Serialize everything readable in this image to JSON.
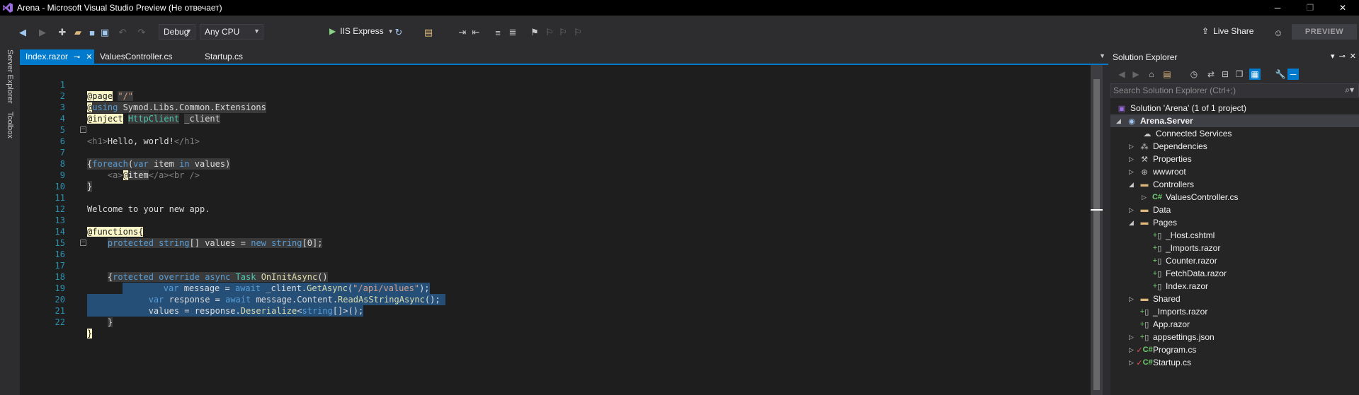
{
  "window": {
    "title": "Arena - Microsoft Visual Studio Preview (Не отвечает)",
    "controls": [
      "─",
      "❐",
      "✕"
    ]
  },
  "toolbar": {
    "config": "Debug",
    "platform": "Any CPU",
    "run_target": "IIS Express",
    "live_share": "Live Share",
    "preview": "PREVIEW"
  },
  "side_tools": [
    "Server Explorer",
    "Toolbox"
  ],
  "tabs": [
    {
      "label": "Index.razor",
      "active": true
    },
    {
      "label": "ValuesController.cs",
      "active": false
    },
    {
      "label": "Startup.cs",
      "active": false
    }
  ],
  "code_lines": [
    {
      "n": "1",
      "text": "@page \"/\""
    },
    {
      "n": "2",
      "text": "@using Symod.Libs.Common.Extensions"
    },
    {
      "n": "3",
      "text": "@inject HttpClient _client"
    },
    {
      "n": "4",
      "text": ""
    },
    {
      "n": "5",
      "text": "<h1>Hello, world!</h1>"
    },
    {
      "n": "6",
      "text": "@foreach(var item in values)"
    },
    {
      "n": "7",
      "text": "{"
    },
    {
      "n": "8",
      "text": "    <a>@item</a><br />"
    },
    {
      "n": "9",
      "text": "}"
    },
    {
      "n": "10",
      "text": ""
    },
    {
      "n": "11",
      "text": "Welcome to your new app."
    },
    {
      "n": "12",
      "text": ""
    },
    {
      "n": "13",
      "text": "@functions{"
    },
    {
      "n": "14",
      "text": "    protected string[] values = new string[0];"
    },
    {
      "n": "15",
      "text": ""
    },
    {
      "n": "16",
      "text": "    protected override async Task OnInitAsync()"
    },
    {
      "n": "17",
      "text": "    {"
    },
    {
      "n": "18",
      "text": "        var message = await _client.GetAsync(\"/api/values\");"
    },
    {
      "n": "19",
      "text": "        var response = await message.Content.ReadAsStringAsync();"
    },
    {
      "n": "20",
      "text": "        values = response.Deserialize<string[]>();"
    },
    {
      "n": "21",
      "text": "    }"
    },
    {
      "n": "22",
      "text": "}"
    }
  ],
  "solution_explorer": {
    "title": "Solution Explorer",
    "search_placeholder": "Search Solution Explorer (Ctrl+;)",
    "nodes": [
      {
        "label": "Solution 'Arena' (1 of 1 project)",
        "icon": "solution-icon"
      },
      {
        "label": "Arena.Server",
        "icon": "web-project-icon"
      },
      {
        "label": "Connected Services",
        "icon": "connected-services-icon"
      },
      {
        "label": "Dependencies",
        "icon": "dependencies-icon"
      },
      {
        "label": "Properties",
        "icon": "wrench-icon"
      },
      {
        "label": "wwwroot",
        "icon": "globe-icon"
      },
      {
        "label": "Controllers",
        "icon": "folder-icon"
      },
      {
        "label": "ValuesController.cs",
        "icon": "csharp-file-icon"
      },
      {
        "label": "Data",
        "icon": "folder-icon"
      },
      {
        "label": "Pages",
        "icon": "folder-icon"
      },
      {
        "label": "_Host.cshtml",
        "icon": "razor-file-icon"
      },
      {
        "label": "_Imports.razor",
        "icon": "razor-file-icon"
      },
      {
        "label": "Counter.razor",
        "icon": "razor-file-icon"
      },
      {
        "label": "FetchData.razor",
        "icon": "razor-file-icon"
      },
      {
        "label": "Index.razor",
        "icon": "razor-file-icon"
      },
      {
        "label": "Shared",
        "icon": "folder-icon"
      },
      {
        "label": "_Imports.razor",
        "icon": "razor-file-icon"
      },
      {
        "label": "App.razor",
        "icon": "razor-file-icon"
      },
      {
        "label": "appsettings.json",
        "icon": "json-file-icon"
      },
      {
        "label": "Program.cs",
        "icon": "csharp-file-icon"
      },
      {
        "label": "Startup.cs",
        "icon": "csharp-file-icon"
      }
    ]
  },
  "colors": {
    "accent": "#007acc",
    "editor_bg": "#1e1e1e",
    "chrome_bg": "#2d2d30",
    "selection": "#264f78"
  }
}
